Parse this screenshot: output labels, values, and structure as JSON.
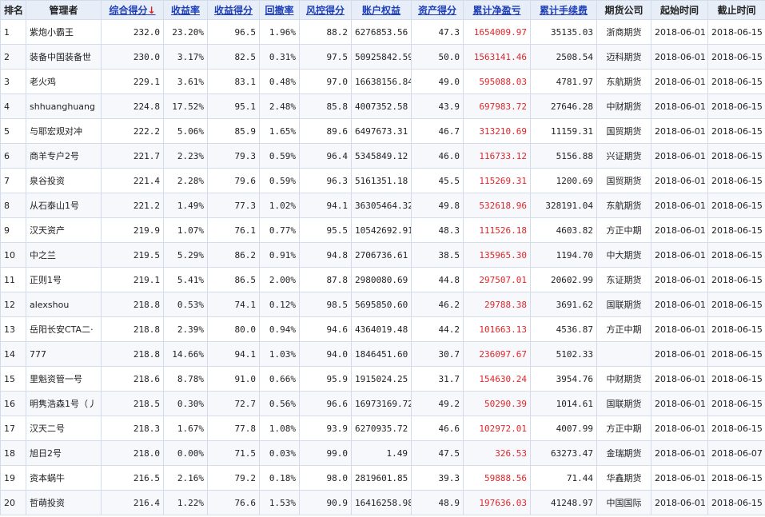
{
  "headers": {
    "rank": "排名",
    "manager": "管理者",
    "total_score": "综合得分",
    "sort_arrow": "↓",
    "return_rate": "收益率",
    "return_score": "收益得分",
    "drawdown": "回撤率",
    "risk_score": "风控得分",
    "equity": "账户权益",
    "asset_score": "资产得分",
    "net_profit": "累计净盈亏",
    "fees": "累计手续费",
    "company": "期货公司",
    "start": "起始时间",
    "end": "截止时间"
  },
  "rows": [
    {
      "rank": "1",
      "manager": "紫炮小霸王",
      "total": "232.0",
      "ret": "23.20%",
      "ret_score": "96.5",
      "dd": "1.96%",
      "risk": "88.2",
      "equity": "6276853.56",
      "asset": "47.3",
      "profit": "1654009.97",
      "fees": "35135.03",
      "company": "浙商期货",
      "start": "2018-06-01",
      "end": "2018-06-15"
    },
    {
      "rank": "2",
      "manager": "装备中国装备世",
      "total": "230.0",
      "ret": "3.17%",
      "ret_score": "82.5",
      "dd": "0.31%",
      "risk": "97.5",
      "equity": "50925842.59",
      "asset": "50.0",
      "profit": "1563141.46",
      "fees": "2508.54",
      "company": "迈科期货",
      "start": "2018-06-01",
      "end": "2018-06-15"
    },
    {
      "rank": "3",
      "manager": "老火鸡",
      "total": "229.1",
      "ret": "3.61%",
      "ret_score": "83.1",
      "dd": "0.48%",
      "risk": "97.0",
      "equity": "16638156.84",
      "asset": "49.0",
      "profit": "595088.03",
      "fees": "4781.97",
      "company": "东航期货",
      "start": "2018-06-01",
      "end": "2018-06-15"
    },
    {
      "rank": "4",
      "manager": "shhuanghuang",
      "total": "224.8",
      "ret": "17.52%",
      "ret_score": "95.1",
      "dd": "2.48%",
      "risk": "85.8",
      "equity": "4007352.58",
      "asset": "43.9",
      "profit": "697983.72",
      "fees": "27646.28",
      "company": "中财期货",
      "start": "2018-06-01",
      "end": "2018-06-15"
    },
    {
      "rank": "5",
      "manager": "与耶宏观对冲",
      "total": "222.2",
      "ret": "5.06%",
      "ret_score": "85.9",
      "dd": "1.65%",
      "risk": "89.6",
      "equity": "6497673.31",
      "asset": "46.7",
      "profit": "313210.69",
      "fees": "11159.31",
      "company": "国贸期货",
      "start": "2018-06-01",
      "end": "2018-06-15"
    },
    {
      "rank": "6",
      "manager": "商羊专户2号",
      "total": "221.7",
      "ret": "2.23%",
      "ret_score": "79.3",
      "dd": "0.59%",
      "risk": "96.4",
      "equity": "5345849.12",
      "asset": "46.0",
      "profit": "116733.12",
      "fees": "5156.88",
      "company": "兴证期货",
      "start": "2018-06-01",
      "end": "2018-06-15"
    },
    {
      "rank": "7",
      "manager": "泉谷投资",
      "total": "221.4",
      "ret": "2.28%",
      "ret_score": "79.6",
      "dd": "0.59%",
      "risk": "96.3",
      "equity": "5161351.18",
      "asset": "45.5",
      "profit": "115269.31",
      "fees": "1200.69",
      "company": "国贸期货",
      "start": "2018-06-01",
      "end": "2018-06-15"
    },
    {
      "rank": "8",
      "manager": "从石泰山1号",
      "total": "221.2",
      "ret": "1.49%",
      "ret_score": "77.3",
      "dd": "1.02%",
      "risk": "94.1",
      "equity": "36305464.32",
      "asset": "49.8",
      "profit": "532618.96",
      "fees": "328191.04",
      "company": "东航期货",
      "start": "2018-06-01",
      "end": "2018-06-15"
    },
    {
      "rank": "9",
      "manager": "汉天资产",
      "total": "219.9",
      "ret": "1.07%",
      "ret_score": "76.1",
      "dd": "0.77%",
      "risk": "95.5",
      "equity": "10542692.91",
      "asset": "48.3",
      "profit": "111526.18",
      "fees": "4603.82",
      "company": "方正中期",
      "start": "2018-06-01",
      "end": "2018-06-15"
    },
    {
      "rank": "10",
      "manager": "中之兰",
      "total": "219.5",
      "ret": "5.29%",
      "ret_score": "86.2",
      "dd": "0.91%",
      "risk": "94.8",
      "equity": "2706736.61",
      "asset": "38.5",
      "profit": "135965.30",
      "fees": "1194.70",
      "company": "中大期货",
      "start": "2018-06-01",
      "end": "2018-06-15"
    },
    {
      "rank": "11",
      "manager": "正则1号",
      "total": "219.1",
      "ret": "5.41%",
      "ret_score": "86.5",
      "dd": "2.00%",
      "risk": "87.8",
      "equity": "2980080.69",
      "asset": "44.8",
      "profit": "297507.01",
      "fees": "20602.99",
      "company": "东证期货",
      "start": "2018-06-01",
      "end": "2018-06-15"
    },
    {
      "rank": "12",
      "manager": "alexshou",
      "total": "218.8",
      "ret": "0.53%",
      "ret_score": "74.1",
      "dd": "0.12%",
      "risk": "98.5",
      "equity": "5695850.60",
      "asset": "46.2",
      "profit": "29788.38",
      "fees": "3691.62",
      "company": "国联期货",
      "start": "2018-06-01",
      "end": "2018-06-15"
    },
    {
      "rank": "13",
      "manager": "岳阳长安CTA二·",
      "total": "218.8",
      "ret": "2.39%",
      "ret_score": "80.0",
      "dd": "0.94%",
      "risk": "94.6",
      "equity": "4364019.48",
      "asset": "44.2",
      "profit": "101663.13",
      "fees": "4536.87",
      "company": "方正中期",
      "start": "2018-06-01",
      "end": "2018-06-15"
    },
    {
      "rank": "14",
      "manager": "777",
      "total": "218.8",
      "ret": "14.66%",
      "ret_score": "94.1",
      "dd": "1.03%",
      "risk": "94.0",
      "equity": "1846451.60",
      "asset": "30.7",
      "profit": "236097.67",
      "fees": "5102.33",
      "company": "",
      "start": "2018-06-01",
      "end": "2018-06-15"
    },
    {
      "rank": "15",
      "manager": "里魁资管一号",
      "total": "218.6",
      "ret": "8.78%",
      "ret_score": "91.0",
      "dd": "0.66%",
      "risk": "95.9",
      "equity": "1915024.25",
      "asset": "31.7",
      "profit": "154630.24",
      "fees": "3954.76",
      "company": "中财期货",
      "start": "2018-06-01",
      "end": "2018-06-15"
    },
    {
      "rank": "16",
      "manager": "明隽浩森1号（丿",
      "total": "218.5",
      "ret": "0.30%",
      "ret_score": "72.7",
      "dd": "0.56%",
      "risk": "96.6",
      "equity": "16973169.72",
      "asset": "49.2",
      "profit": "50290.39",
      "fees": "1014.61",
      "company": "国联期货",
      "start": "2018-06-01",
      "end": "2018-06-15"
    },
    {
      "rank": "17",
      "manager": "汉天二号",
      "total": "218.3",
      "ret": "1.67%",
      "ret_score": "77.8",
      "dd": "1.08%",
      "risk": "93.9",
      "equity": "6270935.72",
      "asset": "46.6",
      "profit": "102972.01",
      "fees": "4007.99",
      "company": "方正中期",
      "start": "2018-06-01",
      "end": "2018-06-15"
    },
    {
      "rank": "18",
      "manager": "旭日2号",
      "total": "218.0",
      "ret": "0.00%",
      "ret_score": "71.5",
      "dd": "0.03%",
      "risk": "99.0",
      "equity": "1.49",
      "asset": "47.5",
      "profit": "326.53",
      "fees": "63273.47",
      "company": "金瑞期货",
      "start": "2018-06-01",
      "end": "2018-06-07"
    },
    {
      "rank": "19",
      "manager": "资本蜗牛",
      "total": "216.5",
      "ret": "2.16%",
      "ret_score": "79.2",
      "dd": "0.18%",
      "risk": "98.0",
      "equity": "2819601.85",
      "asset": "39.3",
      "profit": "59888.56",
      "fees": "71.44",
      "company": "华鑫期货",
      "start": "2018-06-01",
      "end": "2018-06-15"
    },
    {
      "rank": "20",
      "manager": "哲萌投资",
      "total": "216.4",
      "ret": "1.22%",
      "ret_score": "76.6",
      "dd": "1.53%",
      "risk": "90.9",
      "equity": "16416258.98",
      "asset": "48.9",
      "profit": "197636.03",
      "fees": "41248.97",
      "company": "中国国际",
      "start": "2018-06-01",
      "end": "2018-06-15"
    }
  ]
}
